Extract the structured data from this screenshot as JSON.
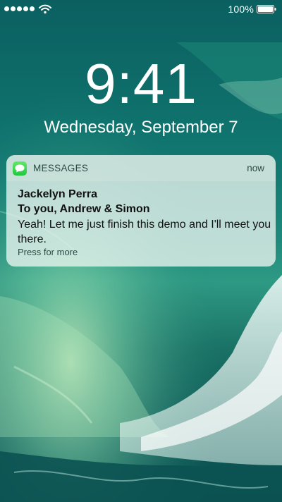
{
  "status_bar": {
    "signal_dots": 5,
    "battery_text": "100%",
    "icons": [
      "signal-dots-icon",
      "wifi-icon",
      "battery-icon"
    ]
  },
  "lock_screen": {
    "time": "9:41",
    "date": "Wednesday, September 7"
  },
  "notification": {
    "app_icon": "messages-icon",
    "app_name": "MESSAGES",
    "time": "now",
    "sender": "Jackelyn Perra",
    "recipients": "To you, Andrew & Simon",
    "message": "Yeah! Let me just finish this demo and I'll meet you there.",
    "action_hint": "Press for more"
  },
  "colors": {
    "messages_green": "#1fc73e",
    "wallpaper_teal": "#0e6e6a"
  }
}
